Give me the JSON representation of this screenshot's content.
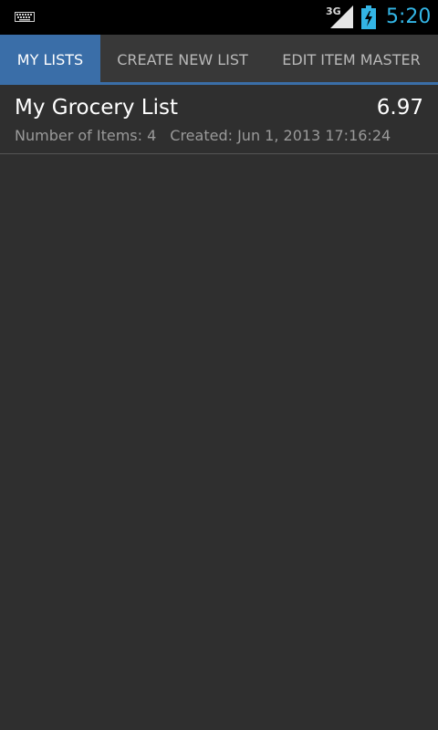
{
  "status_bar": {
    "network_type": "3G",
    "time": "5:20",
    "icons": [
      "keyboard-icon",
      "signal-icon",
      "battery-charging-icon"
    ],
    "clock_color": "#33b5e5"
  },
  "tabs": [
    {
      "label": "MY LISTS",
      "active": true
    },
    {
      "label": "CREATE NEW LIST",
      "active": false
    },
    {
      "label": "EDIT ITEM MASTER",
      "active": false
    }
  ],
  "colors": {
    "accent": "#3a6ea8",
    "background": "#2f2f2f"
  },
  "lists": [
    {
      "name": "My Grocery List",
      "total": "6.97",
      "items_text": "Number of Items: 4",
      "created_text": "Created: Jun 1, 2013 17:16:24"
    }
  ]
}
